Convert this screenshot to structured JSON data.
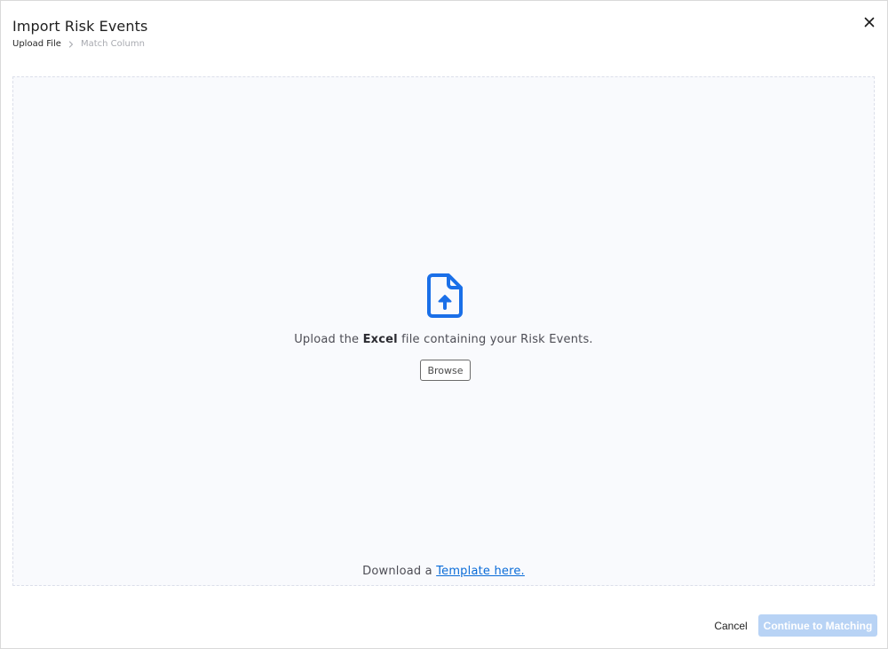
{
  "modal": {
    "title": "Import Risk Events",
    "close_icon": "close-icon"
  },
  "breadcrumb": {
    "steps": [
      {
        "label": "Upload File",
        "state": "active"
      },
      {
        "label": "Match Column",
        "state": "inactive"
      }
    ],
    "separator_icon": "chevron-right-icon"
  },
  "dropzone": {
    "icon": "file-upload-icon",
    "upload_prefix": "Upload the ",
    "upload_bold": "Excel",
    "upload_suffix": " file containing your Risk Events.",
    "browse_label": "Browse",
    "download_prefix": "Download a ",
    "template_link_label": "Template here."
  },
  "footer": {
    "cancel_label": "Cancel",
    "continue_label": "Continue to Matching",
    "continue_disabled": true
  },
  "colors": {
    "accent": "#0a6cd8",
    "icon_blue": "#1a6fe8",
    "disabled_button": "#b8d3f5",
    "dropzone_bg": "#f9fafd",
    "dropzone_border": "#dcdfea"
  }
}
